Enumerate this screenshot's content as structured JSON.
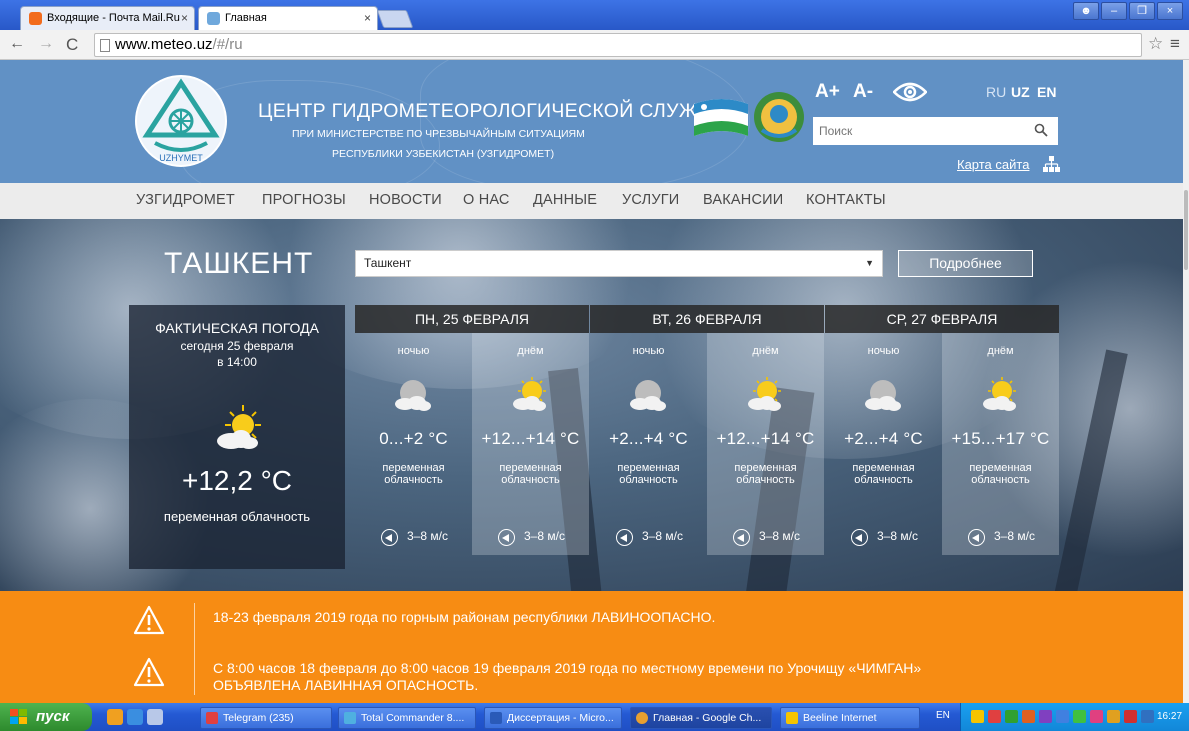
{
  "browser": {
    "tabs": [
      {
        "title": "Входящие - Почта Mail.Ru"
      },
      {
        "title": "Главная"
      }
    ],
    "url_host": "www.meteo.uz",
    "url_path": "/#/ru"
  },
  "header": {
    "org_title": "ЦЕНТР ГИДРОМЕТЕОРОЛОГИЧЕСКОЙ СЛУЖБЫ",
    "org_sub1": "ПРИ МИНИСТЕРСТВЕ ПО ЧРЕЗВЫЧАЙНЫМ СИТУАЦИЯМ",
    "org_sub2": "РЕСПУБЛИКИ УЗБЕКИСТАН (УЗГИДРОМЕТ)",
    "logo_text": "UZHYMET",
    "font_plus": "A+",
    "font_minus": "A-",
    "languages": [
      "RU",
      "UZ",
      "EN"
    ],
    "search_placeholder": "Поиск",
    "sitemap_label": "Карта сайта"
  },
  "nav": {
    "items": [
      "УЗГИДРОМЕТ",
      "ПРОГНОЗЫ",
      "НОВОСТИ",
      "О НАС",
      "ДАННЫЕ",
      "УСЛУГИ",
      "ВАКАНСИИ",
      "КОНТАКТЫ"
    ]
  },
  "weather": {
    "city": "ТАШКЕНТ",
    "city_select_value": "Ташкент",
    "more_button": "Подробнее",
    "current": {
      "title": "ФАКТИЧЕСКАЯ ПОГОДА",
      "date": "сегодня 25 февраля",
      "time": "в 14:00",
      "temp": "+12,2 °C",
      "condition": "переменная облачность",
      "icon": "sun-cloud-icon"
    },
    "days": [
      {
        "label": "ПН, 25 ФЕВРАЛЯ"
      },
      {
        "label": "ВТ, 26 ФЕВРАЛЯ"
      },
      {
        "label": "СР, 27 ФЕВРАЛЯ"
      }
    ],
    "periods": [
      {
        "period": "ночью",
        "temp": "0...+2 °C",
        "cond1": "переменная",
        "cond2": "облачность",
        "wind": "3–8 м/с",
        "icon": "moon-cloud-icon"
      },
      {
        "period": "днём",
        "temp": "+12...+14 °C",
        "cond1": "переменная",
        "cond2": "облачность",
        "wind": "3–8 м/с",
        "icon": "sun-cloud-icon"
      },
      {
        "period": "ночью",
        "temp": "+2...+4 °C",
        "cond1": "переменная",
        "cond2": "облачность",
        "wind": "3–8 м/с",
        "icon": "moon-cloud-icon"
      },
      {
        "period": "днём",
        "temp": "+12...+14 °C",
        "cond1": "переменная",
        "cond2": "облачность",
        "wind": "3–8 м/с",
        "icon": "sun-cloud-icon"
      },
      {
        "period": "ночью",
        "temp": "+2...+4 °C",
        "cond1": "переменная",
        "cond2": "облачность",
        "wind": "3–8 м/с",
        "icon": "moon-cloud-icon"
      },
      {
        "period": "днём",
        "temp": "+15...+17 °C",
        "cond1": "переменная",
        "cond2": "облачность",
        "wind": "3–8 м/с",
        "icon": "sun-cloud-icon"
      }
    ]
  },
  "alerts": [
    {
      "line1": "18-23 февраля 2019 года по горным районам республики ЛАВИНООПАСНО.",
      "line2": ""
    },
    {
      "line1": "С 8:00 часов 18 февраля до 8:00 часов 19 февраля 2019 года по местному времени по Урочищу «ЧИМГАН»",
      "line2": "ОБЪЯВЛЕНА ЛАВИННАЯ ОПАСНОСТЬ."
    }
  ],
  "taskbar": {
    "start": "пуск",
    "buttons": [
      "Telegram (235)",
      "Total Commander 8....",
      "Диссертация - Micro...",
      "Главная - Google Ch...",
      "Beeline Internet"
    ],
    "lang": "EN",
    "clock": "16:27"
  },
  "colors": {
    "header_blue": "#6191c5",
    "alert_orange": "#f78c13",
    "nav_bg": "#ececec"
  }
}
